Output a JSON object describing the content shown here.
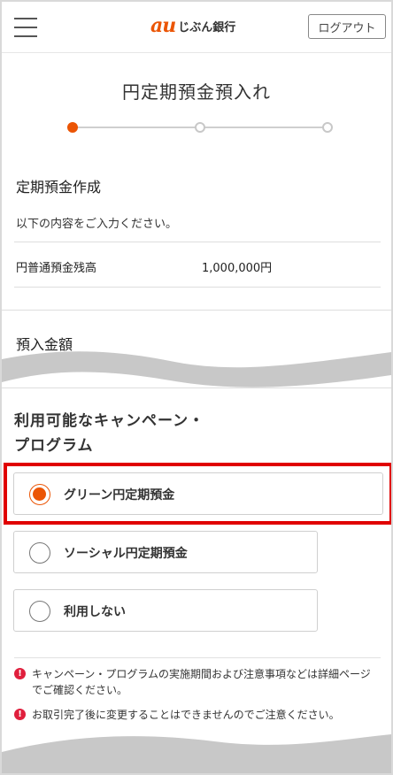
{
  "header": {
    "logo_mark": "au",
    "logo_text": "じぶん銀行",
    "logout_label": "ログアウト",
    "menu_icon": "hamburger-menu-icon"
  },
  "page": {
    "title": "円定期預金預入れ",
    "stepper": {
      "total_steps": 3,
      "current_step": 1
    }
  },
  "form": {
    "section_title": "定期預金作成",
    "intro": "以下の内容をご入力ください。",
    "balance": {
      "label": "円普通預金残高",
      "value": "1,000,000円"
    },
    "amount_label": "預入金額"
  },
  "campaign": {
    "title_line1": "利用可能なキャンペーン・",
    "title_line2": "プログラム",
    "options": [
      {
        "label": "グリーン円定期預金",
        "selected": true
      },
      {
        "label": "ソーシャル円定期預金",
        "selected": false
      },
      {
        "label": "利用しない",
        "selected": false
      }
    ]
  },
  "notes": [
    "キャンペーン・プログラムの実施期間および注意事項などは詳細ページでご確認ください。",
    "お取引完了後に変更することはできませんのでご注意ください。"
  ],
  "colors": {
    "accent": "#eb5505",
    "highlight_border": "#e00000",
    "alert_icon": "#e01f3d",
    "wave": "#c8c8c8"
  }
}
